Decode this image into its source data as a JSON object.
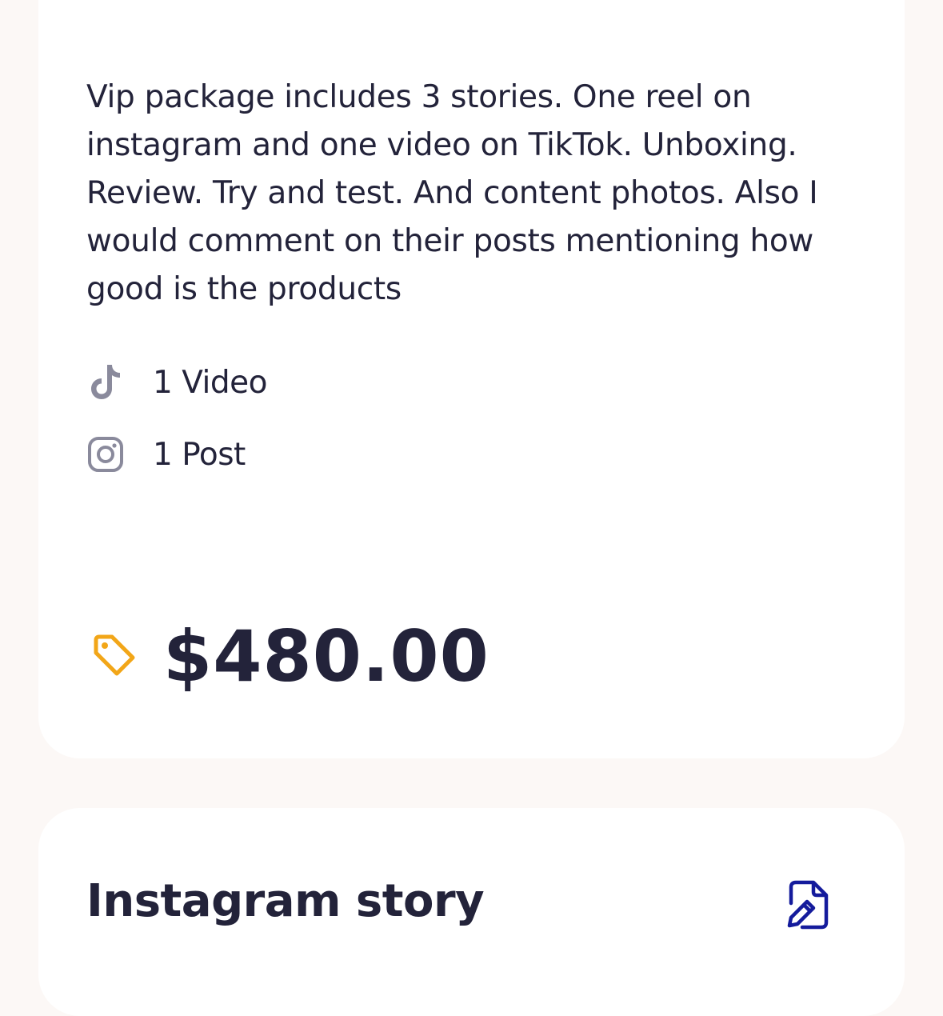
{
  "package": {
    "description": "Vip package includes 3 stories. One reel on instagram and one video on TikTok. Unboxing. Review. Try and test. And content photos. Also I would comment on their posts mentioning how good is the products",
    "deliverables": [
      {
        "icon": "tiktok-icon",
        "label": "1 Video"
      },
      {
        "icon": "instagram-icon",
        "label": "1 Post"
      }
    ],
    "price": "$480.00",
    "price_icon": "price-tag-icon"
  },
  "story_card": {
    "title": "Instagram story",
    "action_icon": "edit-document-icon"
  },
  "colors": {
    "background": "#fcf8f6",
    "card": "#ffffff",
    "text": "#23233a",
    "icon_muted": "#8a8a9c",
    "price_tag": "#f2a618",
    "edit_icon": "#141b9c"
  }
}
